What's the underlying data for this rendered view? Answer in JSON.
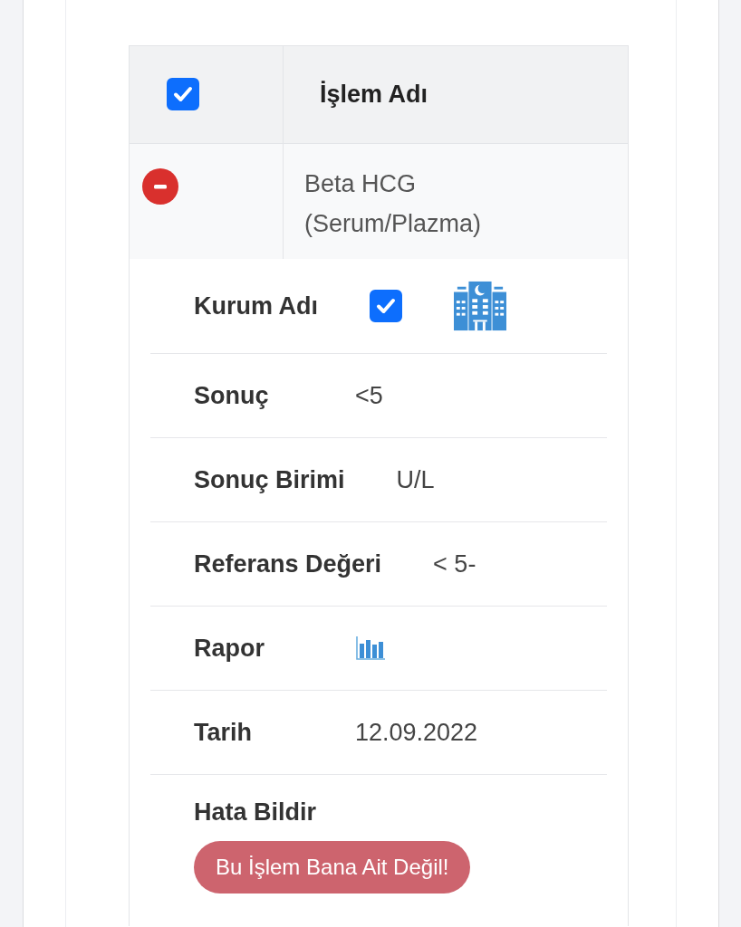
{
  "table": {
    "select_all": {
      "checked": true
    },
    "column_header": "İşlem Adı",
    "rows": [
      {
        "expanded": true,
        "name": "Beta HCG (Serum/Plazma)",
        "details": [
          {
            "kind": "institution",
            "label": "Kurum Adı",
            "checked": true
          },
          {
            "kind": "text",
            "label": "Sonuç",
            "value": "<5"
          },
          {
            "kind": "text",
            "label": "Sonuç Birimi",
            "value": "U/L"
          },
          {
            "kind": "text",
            "label": "Referans Değeri",
            "value": "< 5-"
          },
          {
            "kind": "report",
            "label": "Rapor"
          },
          {
            "kind": "text",
            "label": "Tarih",
            "value": "12.09.2022"
          },
          {
            "kind": "button",
            "label": "Hata Bildir",
            "button": "Bu İşlem Bana Ait Değil!"
          }
        ]
      }
    ]
  }
}
